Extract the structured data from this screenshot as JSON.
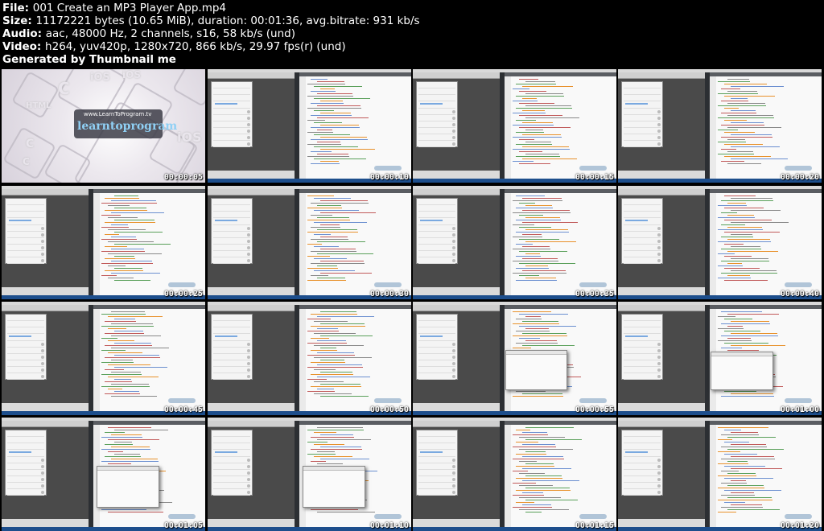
{
  "header": {
    "lines": [
      {
        "label": "File:",
        "value": "001 Create an MP3 Player App.mp4"
      },
      {
        "label": "Size:",
        "value": "11172221 bytes (10.65 MiB), duration: 00:01:36, avg.bitrate: 931 kb/s"
      },
      {
        "label": "Audio:",
        "value": "aac, 48000 Hz, 2 channels, s16, 58 kb/s (und)"
      },
      {
        "label": "Video:",
        "value": "h264, yuv420p, 1280x720, 866 kb/s, 29.97 fps(r) (und)"
      },
      {
        "label": "Generated by Thumbnail me",
        "value": ""
      }
    ]
  },
  "intro": {
    "url": "www.LearnToProgram.tv",
    "brand": "learntoprogram",
    "letters": [
      "C",
      "iOS",
      "iOS",
      "C",
      "C",
      "iOS",
      "HTML"
    ]
  },
  "player_menu": [
    "Play",
    "Pause",
    "Stop",
    "Volume",
    "Songs",
    "Sunshine",
    "I See",
    "The Final Rewind",
    "Audio Boost",
    "Watching"
  ],
  "thumbnails": [
    {
      "time": "00:00:05",
      "kind": "intro"
    },
    {
      "time": "00:00:10",
      "kind": "screen"
    },
    {
      "time": "00:00:15",
      "kind": "screen"
    },
    {
      "time": "00:00:20",
      "kind": "screen"
    },
    {
      "time": "00:00:25",
      "kind": "screen"
    },
    {
      "time": "00:00:30",
      "kind": "screen"
    },
    {
      "time": "00:00:35",
      "kind": "screen"
    },
    {
      "time": "00:00:40",
      "kind": "screen"
    },
    {
      "time": "00:00:45",
      "kind": "screen"
    },
    {
      "time": "00:00:50",
      "kind": "screen"
    },
    {
      "time": "00:00:55",
      "kind": "dialog"
    },
    {
      "time": "00:01:00",
      "kind": "dialog"
    },
    {
      "time": "00:01:05",
      "kind": "dialog"
    },
    {
      "time": "00:01:10",
      "kind": "dialog"
    },
    {
      "time": "00:01:15",
      "kind": "screen"
    },
    {
      "time": "00:01:20",
      "kind": "screen"
    }
  ],
  "colors": {
    "background": "#000000",
    "text": "#ffffff",
    "taskbar": "#1d4e8c",
    "code_orange": "#e8912b",
    "code_blue": "#6b8fd0"
  }
}
